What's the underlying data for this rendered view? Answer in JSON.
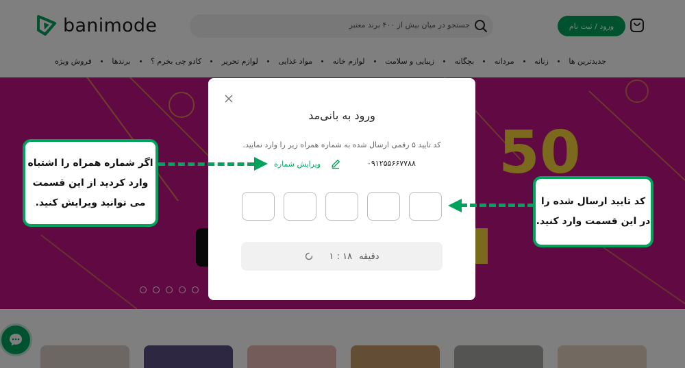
{
  "header": {
    "logo_text": "banimode",
    "search_placeholder": "جستجو در میان بیش از ۴۰۰ برند معتبر",
    "login_label": "ورود / ثبت نام"
  },
  "nav": {
    "items": [
      "جدیدترین ها",
      "زنانه",
      "مردانه",
      "بچگانه",
      "زیبایی و سلامت",
      "لوازم خانه",
      "مواد غذایی",
      "لوازم تحریر",
      "کادو چی بخرم ؟",
      "برندها",
      "فروش ویژه"
    ]
  },
  "banner": {
    "big_number": "50"
  },
  "modal": {
    "title": "ورود به بانی‌مد",
    "subtitle": "کد تایید ۵ رقمی ارسال شده به شماره همراه زیر را وارد نمایید.",
    "phone": "۰۹۱۲۵۵۶۶۷۷۸۸",
    "edit_label": "ویرایش شماره",
    "otp_count": 5,
    "timer_value": "۱ : ۱۸",
    "timer_unit": "دقیقه"
  },
  "callouts": {
    "left_lines": [
      "اگر شماره همراه را اشتباه",
      "وارد کردید از این قسمت",
      "می توانید ویرایش کنید."
    ],
    "right_lines": [
      "کد تایید ارسال شده را",
      "در این قسمت وارد کنید."
    ]
  },
  "colors": {
    "brand_green": "#00a35c",
    "banner_magenta": "#c21384",
    "banner_yellow": "#f7d43a"
  }
}
